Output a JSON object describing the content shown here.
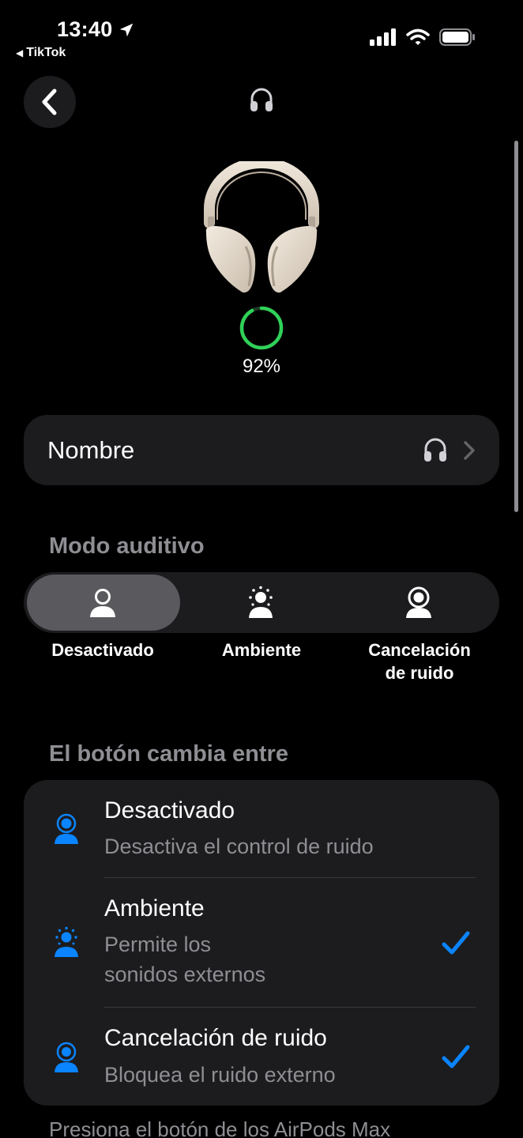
{
  "status_bar": {
    "time": "13:40",
    "back_app": "TikTok",
    "icons": [
      "location-arrow-icon",
      "signal-icon",
      "wifi-icon",
      "battery-icon"
    ]
  },
  "header": {
    "back_icon": "chevron-left-icon",
    "device_icon": "headphones-icon"
  },
  "device": {
    "battery_percent_text": "92%",
    "battery_level": 0.92,
    "ring_color": "#30d158"
  },
  "name_row": {
    "label": "Nombre",
    "icon": "headphones-icon"
  },
  "listening_mode": {
    "title": "Modo auditivo",
    "options": [
      {
        "label": "Desactivado",
        "selected": true
      },
      {
        "label": "Ambiente",
        "selected": false
      },
      {
        "label_line1": "Cancelación",
        "label_line2": "de ruido",
        "selected": false
      }
    ]
  },
  "button_cycles": {
    "title": "El botón cambia entre",
    "accent": "#0a84ff",
    "options": [
      {
        "title": "Desactivado",
        "subtitle": "Desactiva el control de ruido",
        "checked": false
      },
      {
        "title": "Ambiente",
        "subtitle_line1": "Permite los",
        "subtitle_line2": "sonidos externos",
        "checked": true
      },
      {
        "title": "Cancelación de ruido",
        "subtitle": "Bloquea el ruido externo",
        "checked": true
      }
    ]
  },
  "footer_note": "Presiona el botón de los AirPods Max"
}
